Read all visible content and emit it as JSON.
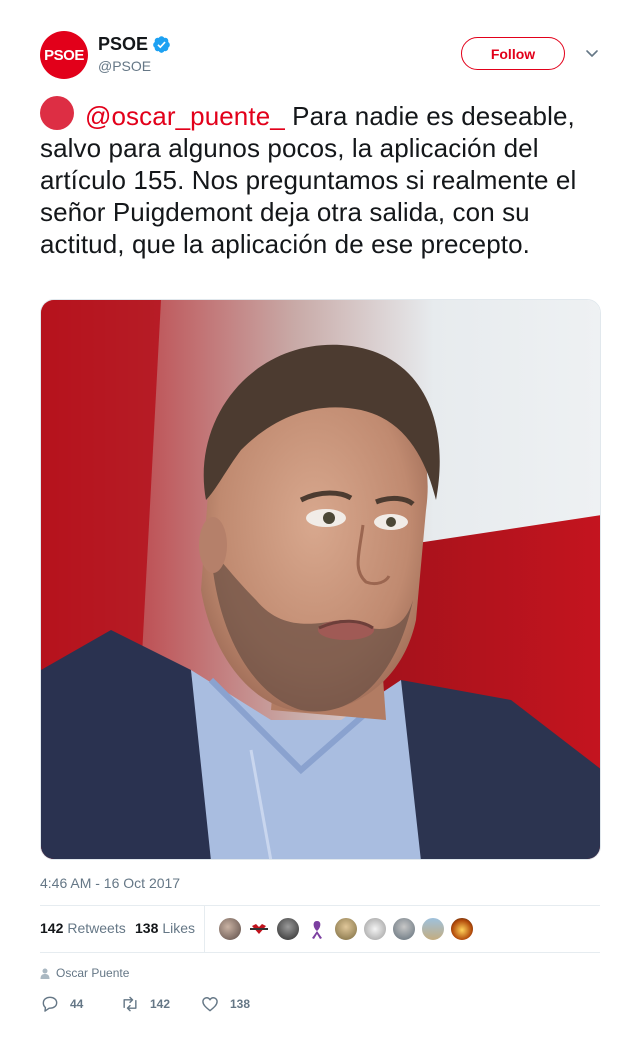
{
  "account": {
    "avatar_text": "PSOE",
    "display_name": "PSOE",
    "handle": "@PSOE",
    "verified": true,
    "brand_color": "#e2001a"
  },
  "follow_label": "Follow",
  "tweet": {
    "mention": "@oscar_puente_",
    "body": " Para nadie es deseable, salvo para algunos pocos, la aplicación del artículo 155. Nos preguntamos si realmente el señor Puigdemont deja otra salida, con su actitud, que la aplicación de ese precepto.",
    "emoji": "red-circle"
  },
  "timestamp": "4:46 AM - 16 Oct 2017",
  "stats": {
    "retweets_count": "142",
    "retweets_label": "Retweets",
    "likes_count": "138",
    "likes_label": "Likes"
  },
  "context_user": "Oscar Puente",
  "actions": {
    "reply_count": "44",
    "retweet_count": "142",
    "like_count": "138"
  }
}
